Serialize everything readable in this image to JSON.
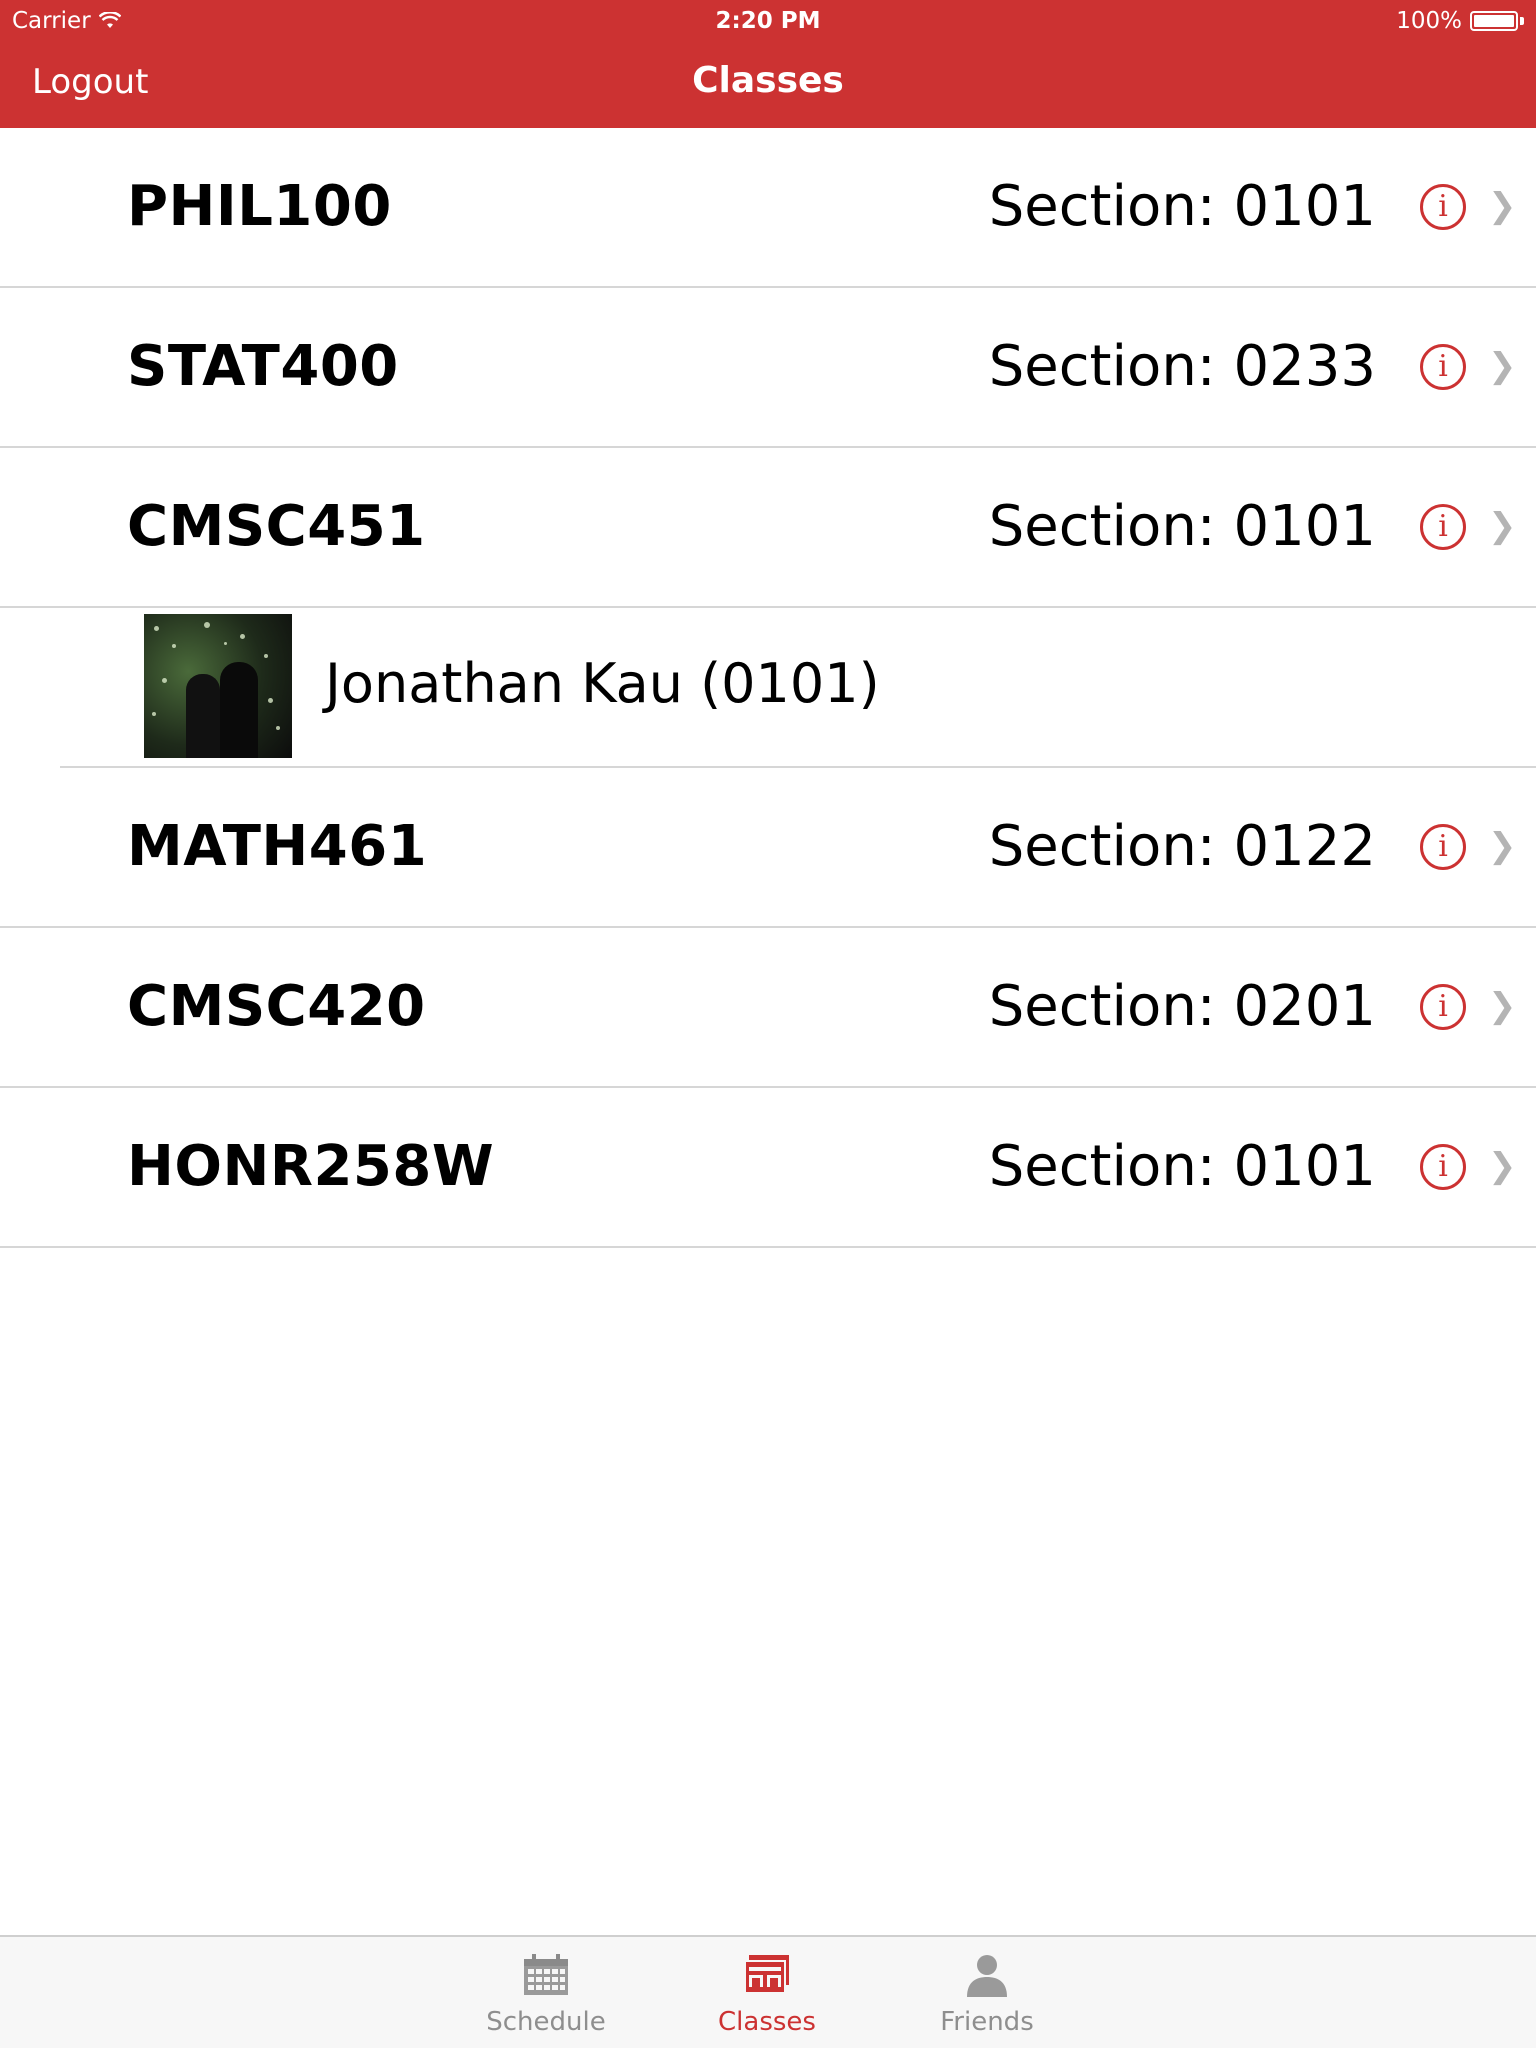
{
  "status_bar": {
    "carrier": "Carrier",
    "time": "2:20 PM",
    "battery": "100%",
    "battery_level": 1.0
  },
  "nav": {
    "left_button": "Logout",
    "title": "Classes"
  },
  "colors": {
    "accent": "#cc3232",
    "separator": "#d6d6d6",
    "chevron": "#b4b4b4",
    "tab_inactive": "#8e8e8e"
  },
  "classes": [
    {
      "course": "PHIL100",
      "section": "Section: 0101"
    },
    {
      "course": "STAT400",
      "section": "Section: 0233"
    },
    {
      "course": "CMSC451",
      "section": "Section: 0101"
    },
    {
      "course": "MATH461",
      "section": "Section: 0122"
    },
    {
      "course": "CMSC420",
      "section": "Section: 0201"
    },
    {
      "course": "HONR258W",
      "section": "Section: 0101"
    }
  ],
  "friend": {
    "name": "Jonathan Kau (0101)",
    "avatar_icon": "friend-photo"
  },
  "row_icons": {
    "info": "info-icon",
    "chevron": "chevron-right-icon"
  },
  "tabs": [
    {
      "label": "Schedule",
      "icon": "calendar-icon",
      "active": false
    },
    {
      "label": "Classes",
      "icon": "classes-icon",
      "active": true
    },
    {
      "label": "Friends",
      "icon": "person-icon",
      "active": false
    }
  ]
}
